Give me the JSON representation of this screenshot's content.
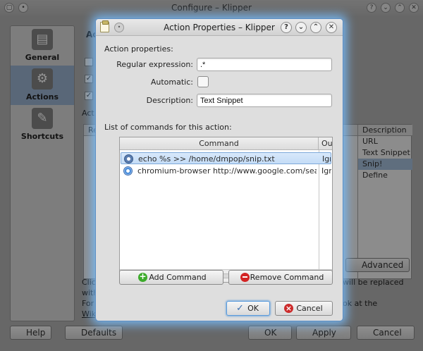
{
  "background_window": {
    "title": "Configure – Klipper",
    "sidebar": [
      {
        "label": "General",
        "selected": false
      },
      {
        "label": "Actions",
        "selected": true
      },
      {
        "label": "Shortcuts",
        "selected": false
      }
    ],
    "descriptions_header": "Description",
    "descriptions": [
      "URL",
      "Text Snippet",
      "Snip!",
      "Define"
    ],
    "partial_texts": {
      "heading": "Ac",
      "actions_label": "Act",
      "regexp_header": "Re",
      "click_line": "Clic",
      "with_line": "with",
      "for_line": "For",
      "wiki_line": "Wiki",
      "replaced_text": "will be replaced",
      "look_text": "ok at the"
    },
    "buttons": {
      "advanced": "Advanced",
      "help": "Help",
      "defaults": "Defaults",
      "ok": "OK",
      "apply": "Apply",
      "cancel": "Cancel"
    }
  },
  "dialog": {
    "title": "Action Properties – Klipper",
    "titlebar_buttons": {
      "help": "?",
      "minimize": "⌄",
      "maximize": "⌃",
      "close": "✕"
    },
    "action_properties_label": "Action properties:",
    "regex_label": "Regular expression:",
    "regex_value": ".*",
    "automatic_label": "Automatic:",
    "automatic_checked": false,
    "description_label": "Description:",
    "description_value": "Text Snippet",
    "commands_label": "List of commands for this action:",
    "commands_table": {
      "headers": [
        "Command",
        "Ou"
      ],
      "rows": [
        {
          "command": "echo %s >> /home/dmpop/snip.txt",
          "output": "Igno",
          "icon": "terminal-icon",
          "selected": true
        },
        {
          "command": "chromium-browser http://www.google.com/search?q=%s",
          "output": "Igno",
          "icon": "chromium-icon",
          "selected": false
        }
      ]
    },
    "add_command_label": "Add Command",
    "remove_command_label": "Remove Command",
    "ok_label": "OK",
    "cancel_label": "Cancel"
  }
}
